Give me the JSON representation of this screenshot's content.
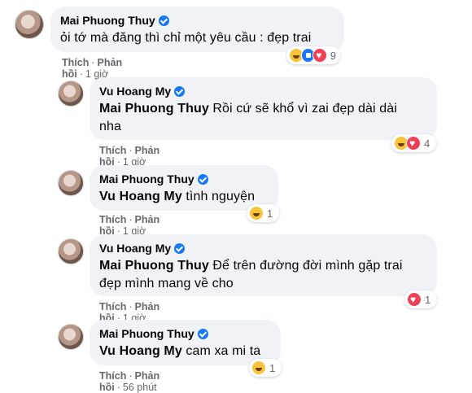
{
  "comments": [
    {
      "author": "Mai Phuong Thuy",
      "text": "ỏi tớ mà đăng thì chỉ một yêu cầu : đẹp trai",
      "like": "Thích",
      "reply": "Phản hồi",
      "time": "1 giờ",
      "reactions": [
        "haha",
        "like",
        "love"
      ],
      "reaction_count": "9"
    },
    {
      "author": "Vu Hoang My",
      "mention": "Mai Phuong Thuy",
      "text_line1": "Rồi cứ sẽ khổ vì zai đẹp dài dài",
      "text_line2": "nha",
      "like": "Thích",
      "reply": "Phản hồi",
      "time": "1 giờ",
      "reactions": [
        "haha",
        "love"
      ],
      "reaction_count": "4"
    },
    {
      "author": "Mai Phuong Thuy",
      "mention": "Vu Hoang My",
      "text": "tình nguyện",
      "like": "Thích",
      "reply": "Phản hồi",
      "time": "1 giờ",
      "reactions": [
        "haha"
      ],
      "reaction_count": "1"
    },
    {
      "author": "Vu Hoang My",
      "mention": "Mai Phuong Thuy",
      "text_line1": "Để trên đường đời mình gặp trai",
      "text_line2": "đẹp mình mang về cho",
      "like": "Thích",
      "reply": "Phản hồi",
      "time": "1 giờ",
      "reactions": [
        "love"
      ],
      "reaction_count": "1"
    },
    {
      "author": "Mai Phuong Thuy",
      "mention": "Vu Hoang My",
      "text": "cam xa mi ta",
      "like": "Thích",
      "reply": "Phản hồi",
      "time": "56 phút",
      "reactions": [
        "haha"
      ],
      "reaction_count": "1"
    }
  ],
  "colors": {
    "bubble": "#f0f2f5",
    "meta_text": "#65676b",
    "verified": "#1877f2",
    "haha": "#f7c43c",
    "like": "#1877f2",
    "love": "#f33e58"
  }
}
